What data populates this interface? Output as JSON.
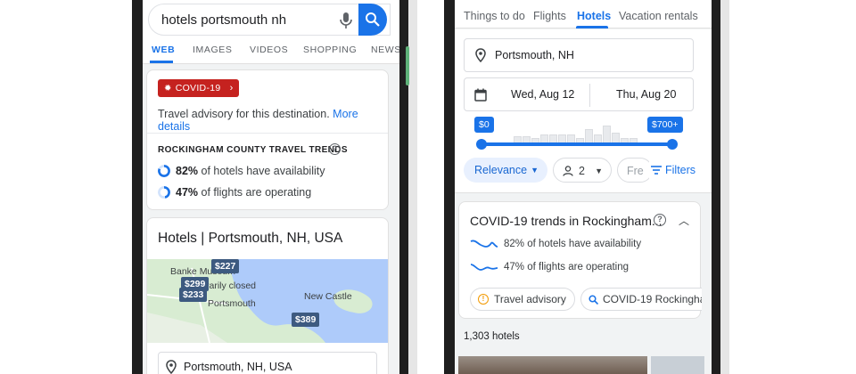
{
  "left": {
    "search": {
      "query": "hotels portsmouth nh"
    },
    "tabs": [
      "WEB",
      "IMAGES",
      "VIDEOS",
      "SHOPPING",
      "NEWS"
    ],
    "covid": {
      "badge": "COVID-19",
      "advisory_text": "Travel advisory for this destination.",
      "advisory_link": "More details",
      "trends_title": "ROCKINGHAM COUNTY TRAVEL TRENDS",
      "hotels_pct": "82%",
      "hotels_text": " of hotels have availability",
      "flights_pct": "47%",
      "flights_text": " of flights are operating"
    },
    "hotels": {
      "title": "Hotels | Portsmouth, NH, USA",
      "pins": [
        "$227",
        "$299",
        "$233",
        "$389"
      ],
      "map_labels": [
        "Banke Museum",
        "rarily closed",
        "Portsmouth",
        "New Castle"
      ],
      "location": "Portsmouth, NH, USA"
    }
  },
  "right": {
    "tabs": [
      "Things to do",
      "Flights",
      "Hotels",
      "Vacation rentals"
    ],
    "location": "Portsmouth, NH",
    "checkin": "Wed, Aug 12",
    "checkout": "Thu, Aug 20",
    "price_min": "$0",
    "price_max": "$700+",
    "sort": "Relevance",
    "guests": "2",
    "free_chip": "Fre",
    "filters": "Filters",
    "covid": {
      "title": "COVID-19 trends in Rockingham...",
      "hotels": "82% of hotels have availability",
      "flights": "47% of flights are operating",
      "chip1": "Travel advisory",
      "chip2": "COVID-19 Rockingha"
    },
    "hotel_count": "1,303 hotels"
  },
  "colors": {
    "accent": "#1a73e8",
    "covid_red": "#c5221f"
  }
}
